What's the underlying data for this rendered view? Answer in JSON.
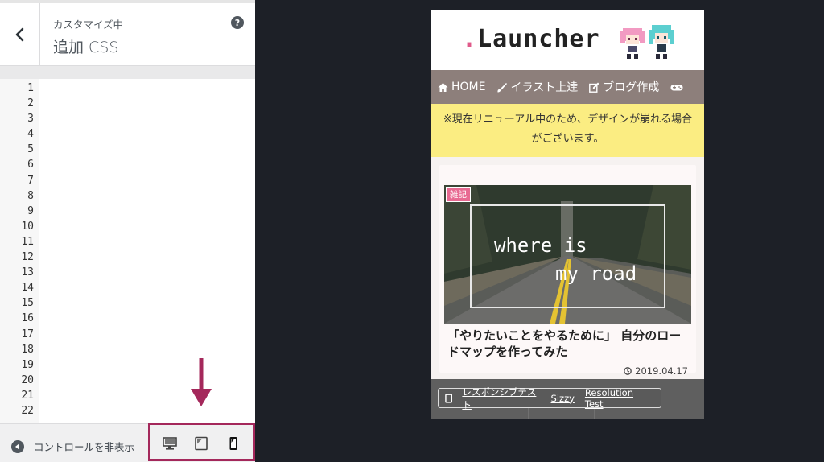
{
  "panel": {
    "subtitle": "カスタマイズ中",
    "title": "追加 CSS",
    "help_glyph": "?",
    "line_numbers": [
      "1",
      "2",
      "3",
      "4",
      "5",
      "6",
      "7",
      "8",
      "9",
      "10",
      "11",
      "12",
      "13",
      "14",
      "15",
      "16",
      "17",
      "18",
      "19",
      "20",
      "21",
      "22"
    ],
    "footer": {
      "hide_controls_label": "コントロールを非表示"
    },
    "highlight_color": "#a4285b"
  },
  "preview": {
    "logo_dot": ".",
    "logo_text": "Launcher",
    "nav": [
      {
        "icon": "home-icon",
        "label": "HOME"
      },
      {
        "icon": "brush-icon",
        "label": "イラスト上達"
      },
      {
        "icon": "edit-icon",
        "label": "ブログ作成"
      }
    ],
    "notice": "※現在リニューアル中のため、デザインが崩れる場合がございます。",
    "card": {
      "badge": "雑記",
      "image_line1": "where is",
      "image_line2": "my road",
      "title": "「やりたいことをやるために」 自分のロードマップを作ってみた",
      "date": "2019.04.17"
    },
    "test_links": [
      "レスポンシブテスト",
      "Sizzy",
      "Resolution Test"
    ]
  }
}
